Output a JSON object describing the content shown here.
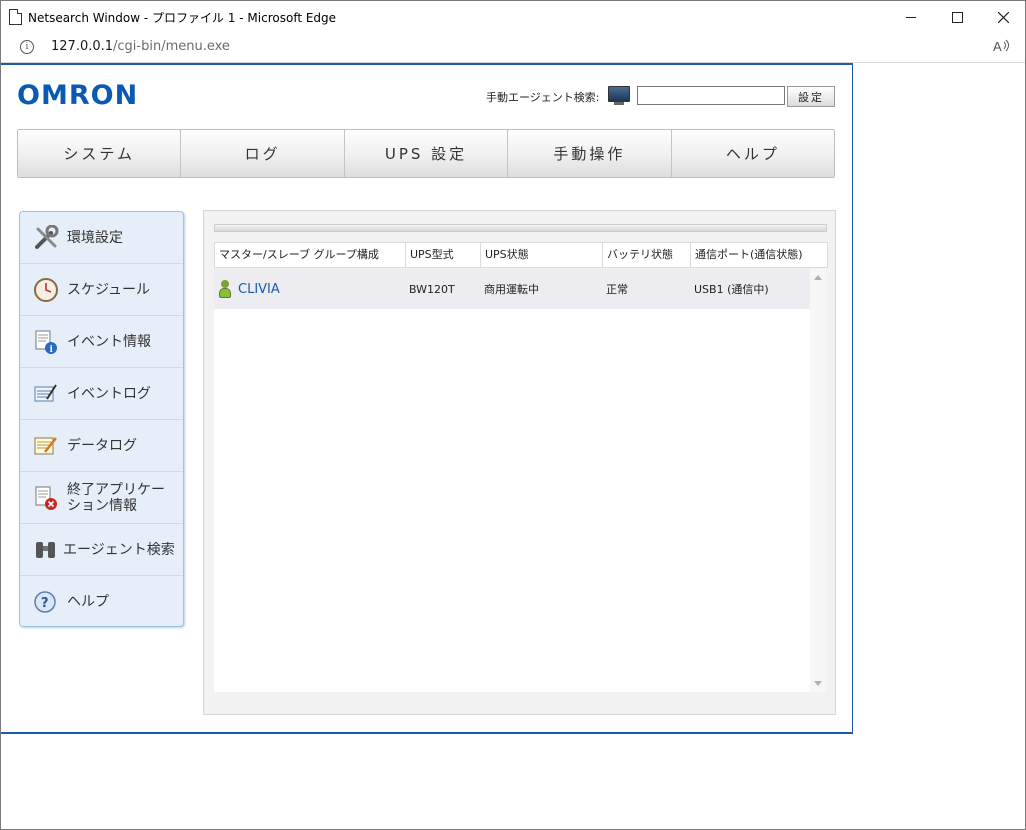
{
  "browser": {
    "title": "Netsearch Window - プロファイル 1 - Microsoft Edge",
    "url_host": "127.0.0.1",
    "url_path": "/cgi-bin/menu.exe",
    "read_aloud": "Aͅ"
  },
  "header": {
    "logo": "OMRON",
    "search_label": "手動エージェント検索:",
    "search_value": "",
    "set_button": "設定"
  },
  "tabs": [
    {
      "label": "システム"
    },
    {
      "label": "ログ"
    },
    {
      "label": "UPS 設定"
    },
    {
      "label": "手動操作"
    },
    {
      "label": "ヘルプ"
    }
  ],
  "sidebar": {
    "items": [
      {
        "label": "環境設定",
        "icon": "tools-icon"
      },
      {
        "label": "スケジュール",
        "icon": "clock-icon"
      },
      {
        "label": "イベント情報",
        "icon": "event-info-icon"
      },
      {
        "label": "イベントログ",
        "icon": "event-log-icon"
      },
      {
        "label": "データログ",
        "icon": "data-log-icon"
      },
      {
        "label": "終了アプリケーション情報",
        "icon": "shutdown-app-icon"
      },
      {
        "label": "エージェント検索",
        "icon": "binoculars-icon"
      },
      {
        "label": "ヘルプ",
        "icon": "help-icon"
      }
    ]
  },
  "table": {
    "columns": [
      "マスター/スレーブ グループ構成",
      "UPS型式",
      "UPS状態",
      "バッテリ状態",
      "通信ポート(通信状態)"
    ],
    "rows": [
      {
        "name": "CLIVIA",
        "model": "BW120T",
        "ups_status": "商用運転中",
        "battery": "正常",
        "port": "USB1 (通信中)"
      }
    ]
  },
  "colors": {
    "brand": "#0a5ab4",
    "frame_border": "#1f5aa6",
    "sidebar_bg": "#e6eff9",
    "link": "#1f5aa6"
  }
}
